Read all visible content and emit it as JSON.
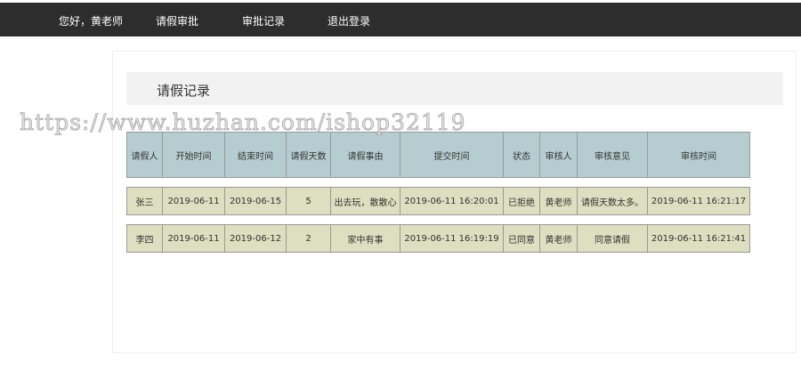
{
  "nav": {
    "greeting": "您好，黄老师",
    "approve": "请假审批",
    "records": "审批记录",
    "logout": "退出登录"
  },
  "page_title": "请假记录",
  "watermark": "https://www.huzhan.com/ishop32119",
  "table": {
    "headers": [
      "请假人",
      "开始时间",
      "结束时间",
      "请假天数",
      "请假事由",
      "提交时间",
      "状态",
      "审核人",
      "审核意见",
      "审核时间"
    ],
    "rows": [
      [
        "张三",
        "2019-06-11",
        "2019-06-15",
        "5",
        "出去玩，散散心",
        "2019-06-11 16:20:01",
        "已拒绝",
        "黄老师",
        "请假天数太多。",
        "2019-06-11 16:21:17"
      ],
      [
        "李四",
        "2019-06-11",
        "2019-06-12",
        "2",
        "家中有事",
        "2019-06-11 16:19:19",
        "已同意",
        "黄老师",
        "同意请假",
        "2019-06-11 16:21:41"
      ]
    ]
  }
}
